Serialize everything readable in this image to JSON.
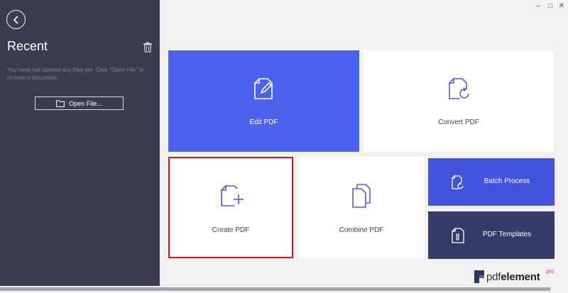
{
  "sidebar": {
    "title": "Recent",
    "empty_message": "You have not opened any files yet. Click \"Open File\" to choose a document.",
    "open_file_label": "Open File..."
  },
  "window_controls": {
    "minimize": "–",
    "maximize": "□",
    "close": "✕"
  },
  "tiles": {
    "edit": "Edit PDF",
    "convert": "Convert PDF",
    "create": "Create PDF",
    "combine": "Combine PDF",
    "batch": "Batch Process",
    "templates": "PDF Templates"
  },
  "logo": {
    "name_light": "pdf",
    "name_bold": "element",
    "badge": "pro"
  },
  "colors": {
    "sidebar_bg": "#3a3c52",
    "edit_tile": "#4b62f1",
    "batch_tile": "#4253dc",
    "templates_tile": "#363c6a",
    "selection_border": "#d9141b"
  }
}
